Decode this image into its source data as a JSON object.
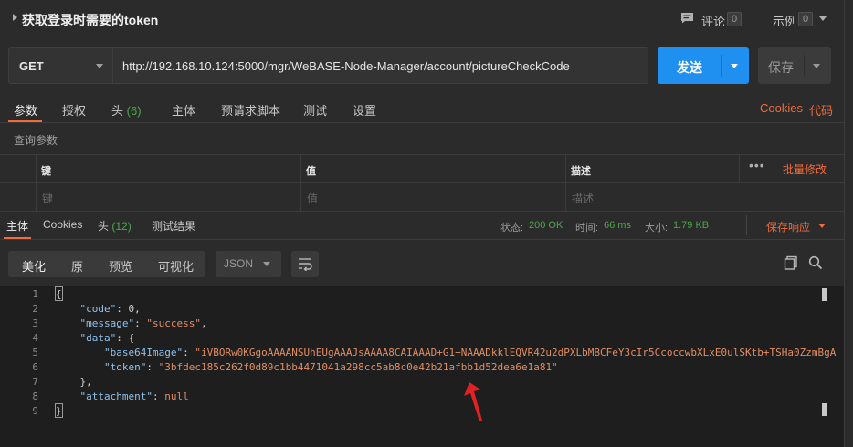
{
  "request": {
    "title": "获取登录时需要的token",
    "comments_label": "评论",
    "comments_count": "0",
    "examples_label": "示例",
    "examples_count": "0"
  },
  "url_bar": {
    "method": "GET",
    "url": "http://192.168.10.124:5000/mgr/WeBASE-Node-Manager/account/pictureCheckCode",
    "send_label": "发送",
    "save_label": "保存"
  },
  "request_tabs": [
    {
      "label": "参数",
      "active": true
    },
    {
      "label": "授权"
    },
    {
      "label": "头",
      "count": "(6)"
    },
    {
      "label": "主体"
    },
    {
      "label": "预请求脚本"
    },
    {
      "label": "测试"
    },
    {
      "label": "设置"
    }
  ],
  "request_links": {
    "cookies": "Cookies",
    "code": "代码"
  },
  "query_params": {
    "section_label": "查询参数",
    "columns": [
      "键",
      "值",
      "描述"
    ],
    "placeholders": [
      "键",
      "值",
      "描述"
    ],
    "bulk_edit": "批量修改",
    "more": "•••"
  },
  "response_tabs": [
    {
      "label": "主体",
      "active": true
    },
    {
      "label": "Cookies"
    },
    {
      "label": "头",
      "count": "(12)"
    },
    {
      "label": "测试结果"
    }
  ],
  "response_meta": {
    "status_label": "状态:",
    "status_value": "200 OK",
    "time_label": "时间:",
    "time_value": "66 ms",
    "size_label": "大小:",
    "size_value": "1.79 KB",
    "save_response": "保存响应"
  },
  "response_view": {
    "buttons": [
      "美化",
      "原",
      "预览",
      "可视化"
    ],
    "active": "美化",
    "format": "JSON"
  },
  "code_lines": [
    {
      "n": "1",
      "parts": [
        [
          "p",
          "{"
        ]
      ]
    },
    {
      "n": "2",
      "parts": [
        [
          "p",
          "    "
        ],
        [
          "k",
          "\"code\""
        ],
        [
          "p",
          ": "
        ],
        [
          "n",
          "0"
        ],
        [
          "p",
          ","
        ]
      ]
    },
    {
      "n": "3",
      "parts": [
        [
          "p",
          "    "
        ],
        [
          "k",
          "\"message\""
        ],
        [
          "p",
          ": "
        ],
        [
          "s",
          "\"success\""
        ],
        [
          "p",
          ","
        ]
      ]
    },
    {
      "n": "4",
      "parts": [
        [
          "p",
          "    "
        ],
        [
          "k",
          "\"data\""
        ],
        [
          "p",
          ": {"
        ]
      ]
    },
    {
      "n": "5",
      "parts": [
        [
          "p",
          "        "
        ],
        [
          "k",
          "\"base64Image\""
        ],
        [
          "p",
          ": "
        ],
        [
          "s",
          "\"iVBORw0KGgoAAAANSUhEUgAAAJsAAAA8CAIAAAD+G1+NAAADkklEQVR42u2dPXLbMBCFeY3cIr5CcoccwbXLxE0ulSKtb+TSHa0ZzmBgA"
        ]
      ]
    },
    {
      "n": "6",
      "parts": [
        [
          "p",
          "        "
        ],
        [
          "k",
          "\"token\""
        ],
        [
          "p",
          ": "
        ],
        [
          "s",
          "\"3bfdec185c262f0d89c1bb4471041a298cc5ab8c0e42b21afbb1d52dea6e1a81\""
        ]
      ]
    },
    {
      "n": "7",
      "parts": [
        [
          "p",
          "    },"
        ]
      ]
    },
    {
      "n": "8",
      "parts": [
        [
          "p",
          "    "
        ],
        [
          "k",
          "\"attachment\""
        ],
        [
          "p",
          ": "
        ],
        [
          "s",
          "null"
        ]
      ]
    },
    {
      "n": "9",
      "parts": [
        [
          "p",
          "}"
        ]
      ]
    }
  ],
  "icons": {
    "comment": "comment-icon",
    "copy": "copy-icon",
    "search": "search-icon",
    "wrap": "wrap-lines-icon",
    "annotation": "red-arrow-icon"
  },
  "colors": {
    "accent": "#f26b3a",
    "send": "#1f8ff0",
    "status_ok": "#4ca84c",
    "json_key": "#8fc2ee",
    "json_string": "#e28e64"
  }
}
